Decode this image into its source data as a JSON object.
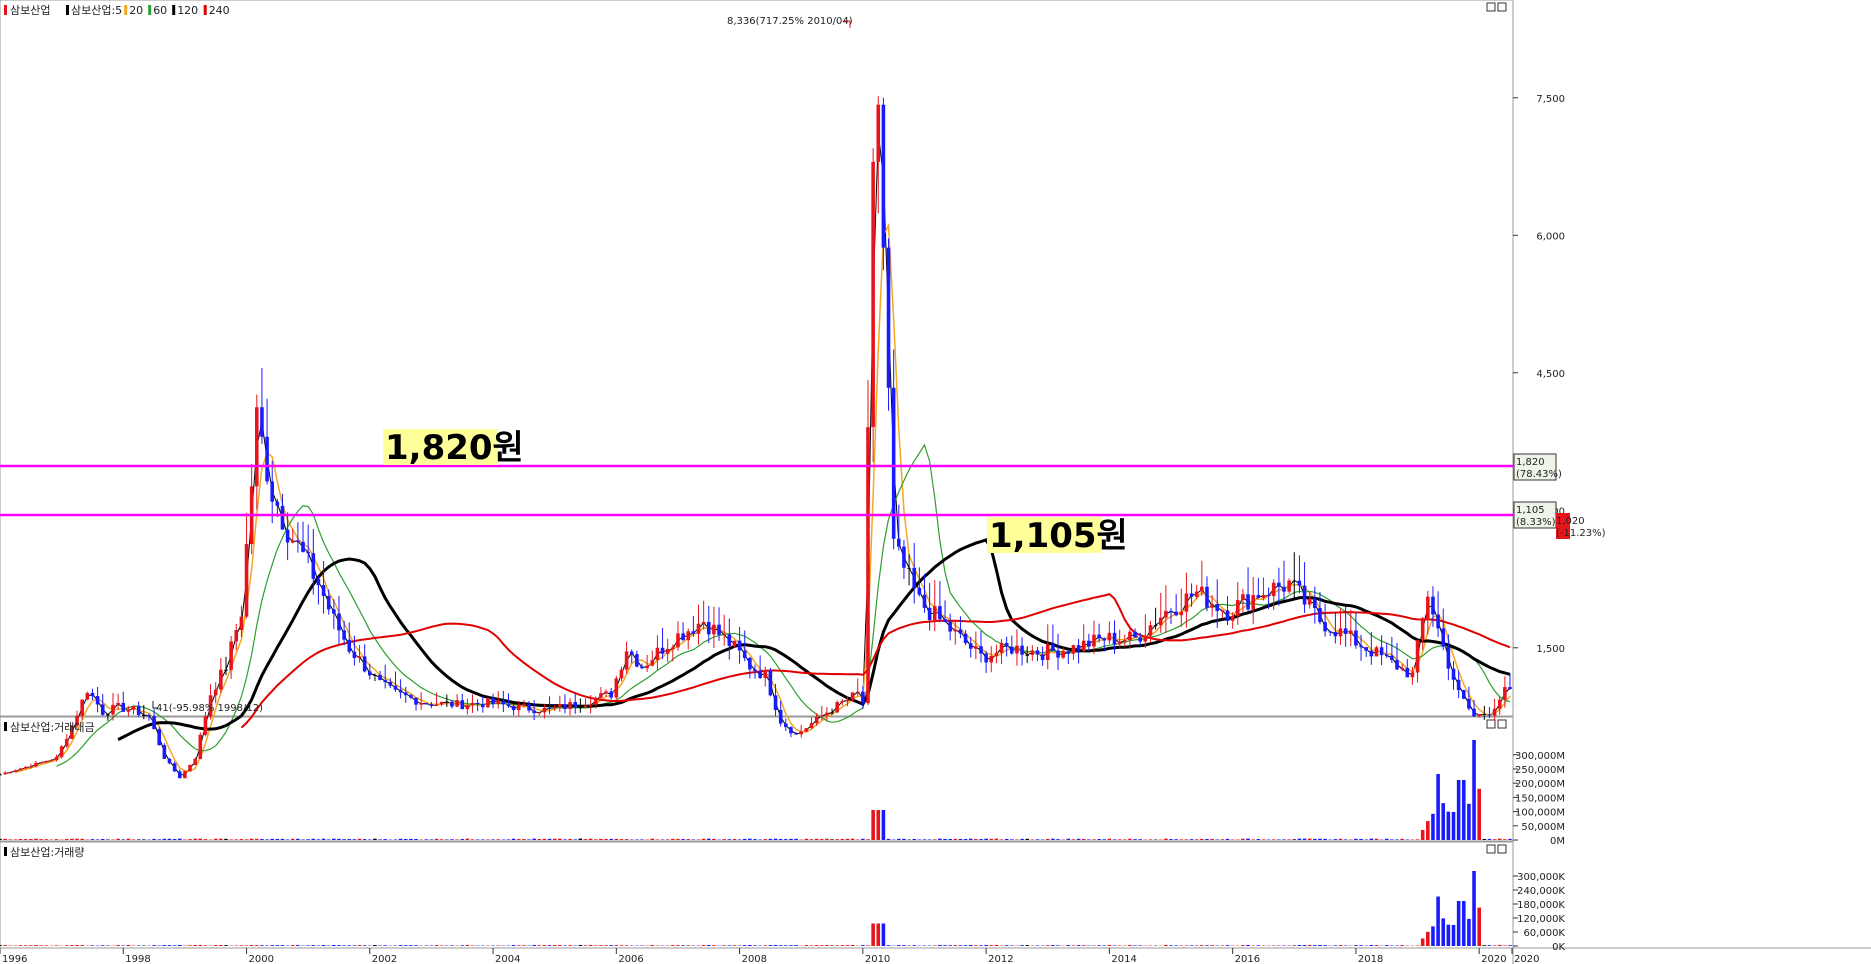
{
  "main_panel": {
    "stock_name": "삼보산업",
    "ma_legend": [
      {
        "label": "삼보산업:5",
        "color": "#000000"
      },
      {
        "label": "20",
        "color": "#f5a623"
      },
      {
        "label": "60",
        "color": "#2e9e2e"
      },
      {
        "label": "120",
        "color": "#000000"
      },
      {
        "label": "240",
        "color": "#e00000"
      }
    ],
    "peak_annotation": "8,336(717.25% 2010/04)",
    "low_annotation": "41(-95.98% 1998/12)",
    "callouts": [
      {
        "text": "1,820원",
        "price": 1820
      },
      {
        "text": "1,105원",
        "price": 1105
      }
    ],
    "price_tags": [
      {
        "line1": "1,820",
        "line2": "(78.43%)",
        "price": 1820
      },
      {
        "line1": "1,105",
        "line2": "(8.33%)",
        "price": 1105
      }
    ],
    "red_tag": {
      "line1": "1,020",
      "line2": "(-11.23%)"
    },
    "y_ticks": [
      "7,500",
      "6,000",
      "4,500",
      "3,000",
      "1,500"
    ]
  },
  "value_panel": {
    "title": "삼보산업:거래대금",
    "y_ticks": [
      "300,000M",
      "250,000M",
      "200,000M",
      "150,000M",
      "100,000M",
      "50,000M",
      "0M"
    ]
  },
  "volume_panel": {
    "title": "삼보산업:거래량",
    "y_ticks": [
      "300,000K",
      "240,000K",
      "180,000K",
      "120,000K",
      "60,000K",
      "0K"
    ]
  },
  "x_axis": {
    "labels": [
      "1996",
      "1998",
      "2000",
      "2002",
      "2004",
      "2006",
      "2008",
      "2010",
      "2012",
      "2014",
      "2016",
      "2018",
      "2020",
      "2020"
    ]
  },
  "colors": {
    "up": "#e8141c",
    "down": "#1a1aff",
    "flat": "#000000",
    "highlight_line": "#ff00ff",
    "callout_bg": "#ffff99"
  },
  "chart_data": {
    "type": "candlestick",
    "title": "삼보산업",
    "period": "monthly",
    "x_range": [
      "1996-01",
      "2020-06"
    ],
    "price_axis_ticks": [
      1500,
      3000,
      4500,
      6000,
      7500
    ],
    "key_points": [
      {
        "date": "1998-12",
        "price": 41,
        "label": "low"
      },
      {
        "date": "2010-04",
        "price": 8336,
        "label": "high"
      }
    ],
    "horizontal_levels": [
      1820,
      1105
    ],
    "series_points": [
      {
        "date": "1996-01",
        "close": 120
      },
      {
        "date": "1996-06",
        "close": 200
      },
      {
        "date": "1996-12",
        "close": 300
      },
      {
        "date": "1997-03",
        "close": 650
      },
      {
        "date": "1997-06",
        "close": 1050
      },
      {
        "date": "1997-09",
        "close": 800
      },
      {
        "date": "1997-12",
        "close": 850
      },
      {
        "date": "1998-03",
        "close": 820
      },
      {
        "date": "1998-06",
        "close": 750
      },
      {
        "date": "1998-09",
        "close": 300
      },
      {
        "date": "1998-12",
        "close": 80
      },
      {
        "date": "1999-03",
        "close": 300
      },
      {
        "date": "1999-06",
        "close": 1000
      },
      {
        "date": "1999-09",
        "close": 1300
      },
      {
        "date": "1999-12",
        "close": 1900
      },
      {
        "date": "2000-03",
        "close": 4000
      },
      {
        "date": "2000-06",
        "close": 3200
      },
      {
        "date": "2000-09",
        "close": 2800
      },
      {
        "date": "2000-12",
        "close": 2500
      },
      {
        "date": "2001-03",
        "close": 2200
      },
      {
        "date": "2001-06",
        "close": 1800
      },
      {
        "date": "2001-09",
        "close": 1500
      },
      {
        "date": "2001-12",
        "close": 1300
      },
      {
        "date": "2002-03",
        "close": 1100
      },
      {
        "date": "2002-06",
        "close": 1000
      },
      {
        "date": "2002-09",
        "close": 950
      },
      {
        "date": "2002-12",
        "close": 900
      },
      {
        "date": "2003-06",
        "close": 880
      },
      {
        "date": "2003-12",
        "close": 900
      },
      {
        "date": "2004-06",
        "close": 850
      },
      {
        "date": "2004-12",
        "close": 820
      },
      {
        "date": "2005-06",
        "close": 900
      },
      {
        "date": "2005-12",
        "close": 1000
      },
      {
        "date": "2006-03",
        "close": 1500
      },
      {
        "date": "2006-06",
        "close": 1300
      },
      {
        "date": "2006-12",
        "close": 1600
      },
      {
        "date": "2007-06",
        "close": 1800
      },
      {
        "date": "2007-12",
        "close": 1500
      },
      {
        "date": "2008-03",
        "close": 1300
      },
      {
        "date": "2008-06",
        "close": 1200
      },
      {
        "date": "2008-09",
        "close": 700
      },
      {
        "date": "2008-12",
        "close": 550
      },
      {
        "date": "2009-06",
        "close": 800
      },
      {
        "date": "2009-12",
        "close": 1000
      },
      {
        "date": "2010-01",
        "close": 900
      },
      {
        "date": "2010-03",
        "close": 6500
      },
      {
        "date": "2010-04",
        "close": 7500
      },
      {
        "date": "2010-07",
        "close": 2600
      },
      {
        "date": "2010-12",
        "close": 2000
      },
      {
        "date": "2011-06",
        "close": 1700
      },
      {
        "date": "2011-12",
        "close": 1400
      },
      {
        "date": "2012-06",
        "close": 1500
      },
      {
        "date": "2012-12",
        "close": 1450
      },
      {
        "date": "2013-06",
        "close": 1500
      },
      {
        "date": "2013-12",
        "close": 1600
      },
      {
        "date": "2014-06",
        "close": 1600
      },
      {
        "date": "2014-12",
        "close": 1900
      },
      {
        "date": "2015-06",
        "close": 2100
      },
      {
        "date": "2015-12",
        "close": 1900
      },
      {
        "date": "2016-06",
        "close": 2100
      },
      {
        "date": "2016-12",
        "close": 2200
      },
      {
        "date": "2017-06",
        "close": 1800
      },
      {
        "date": "2017-12",
        "close": 1600
      },
      {
        "date": "2018-06",
        "close": 1400
      },
      {
        "date": "2018-12",
        "close": 1200
      },
      {
        "date": "2019-03",
        "close": 2100
      },
      {
        "date": "2019-06",
        "close": 1500
      },
      {
        "date": "2019-09",
        "close": 1000
      },
      {
        "date": "2019-12",
        "close": 750
      },
      {
        "date": "2020-03",
        "close": 800
      },
      {
        "date": "2020-06",
        "close": 1020
      }
    ],
    "panels": [
      "price",
      "trading_value",
      "volume"
    ]
  }
}
